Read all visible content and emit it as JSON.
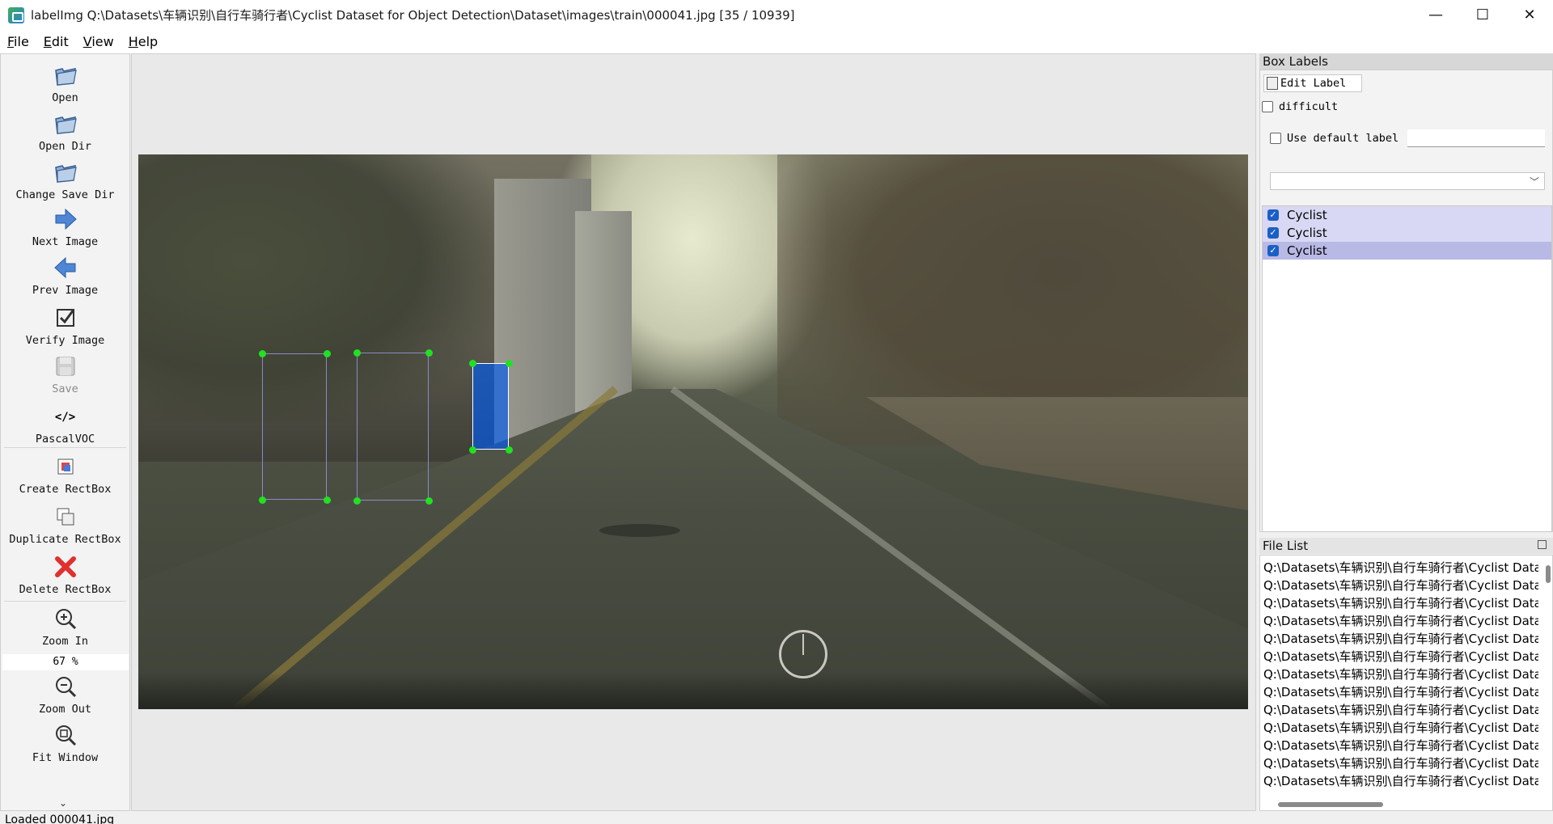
{
  "window": {
    "title": "labelImg Q:\\Datasets\\车辆识别\\自行车骑行者\\Cyclist Dataset for Object Detection\\Dataset\\images\\train\\000041.jpg [35 / 10939]",
    "minimize": "—",
    "maximize": "☐",
    "close": "✕"
  },
  "menu": [
    {
      "accel": "F",
      "rest": "ile"
    },
    {
      "accel": "E",
      "rest": "dit"
    },
    {
      "accel": "V",
      "rest": "iew"
    },
    {
      "accel": "H",
      "rest": "elp"
    }
  ],
  "toolbar": {
    "open": "Open",
    "open_dir": "Open Dir",
    "change_save_dir": "Change Save Dir",
    "next_image": "Next Image",
    "prev_image": "Prev Image",
    "verify_image": "Verify Image",
    "save": "Save",
    "format": "PascalVOC",
    "format_glyph": "</>",
    "create_rectbox": "Create RectBox",
    "duplicate_rectbox": "Duplicate RectBox",
    "delete_rectbox": "Delete RectBox",
    "zoom_in": "Zoom In",
    "zoom_value": "67 %",
    "zoom_out": "Zoom Out",
    "fit_window": "Fit Window",
    "more": "⌄"
  },
  "box_labels": {
    "title": "Box Labels",
    "edit_label": "Edit Label",
    "difficult": "difficult",
    "use_default_label": "Use default label",
    "default_label_value": "",
    "combo_value": "",
    "items": [
      {
        "label": "Cyclist",
        "checked": true,
        "selected": false
      },
      {
        "label": "Cyclist",
        "checked": true,
        "selected": false
      },
      {
        "label": "Cyclist",
        "checked": true,
        "selected": true
      }
    ]
  },
  "file_list": {
    "title": "File List",
    "items": [
      "Q:\\Datasets\\车辆识别\\自行车骑行者\\Cyclist Data",
      "Q:\\Datasets\\车辆识别\\自行车骑行者\\Cyclist Data",
      "Q:\\Datasets\\车辆识别\\自行车骑行者\\Cyclist Data",
      "Q:\\Datasets\\车辆识别\\自行车骑行者\\Cyclist Data",
      "Q:\\Datasets\\车辆识别\\自行车骑行者\\Cyclist Data",
      "Q:\\Datasets\\车辆识别\\自行车骑行者\\Cyclist Data",
      "Q:\\Datasets\\车辆识别\\自行车骑行者\\Cyclist Data",
      "Q:\\Datasets\\车辆识别\\自行车骑行者\\Cyclist Data",
      "Q:\\Datasets\\车辆识别\\自行车骑行者\\Cyclist Data",
      "Q:\\Datasets\\车辆识别\\自行车骑行者\\Cyclist Data",
      "Q:\\Datasets\\车辆识别\\自行车骑行者\\Cyclist Data",
      "Q:\\Datasets\\车辆识别\\自行车骑行者\\Cyclist Data",
      "Q:\\Datasets\\车辆识别\\自行车骑行者\\Cyclist Data"
    ]
  },
  "status": {
    "text": "Loaded 000041.jpg"
  },
  "colors": {
    "vertex": "#22e022",
    "selected_box_fill": "#005af0",
    "label_row": "#d8d8f4",
    "label_row_selected": "#b9b9e6",
    "checkbox_checked": "#1b5fc6"
  }
}
